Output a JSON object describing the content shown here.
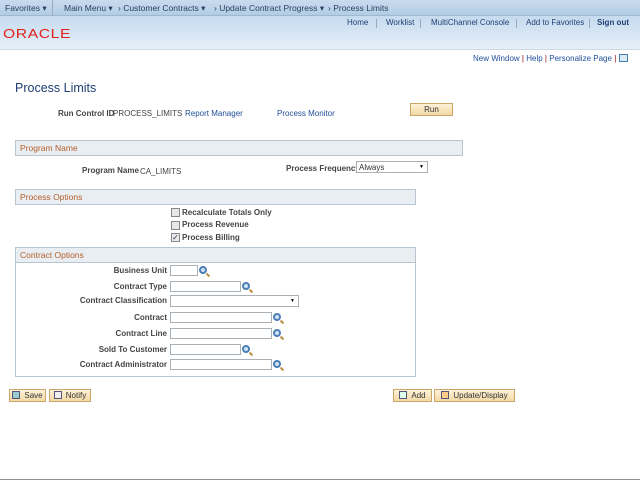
{
  "topnav": {
    "favorites": "Favorites ▾",
    "main_menu": "Main Menu ▾",
    "crumb1": "› Customer Contracts ▾",
    "crumb2": "› Update Contract Progress ▾",
    "crumb3": "› Process Limits"
  },
  "header_links": {
    "home": "Home",
    "worklist": "Worklist",
    "multichannel": "MultiChannel Console",
    "add_favorites": "Add to Favorites",
    "sign_out": "Sign out"
  },
  "logo": "ORACLE",
  "page_links": {
    "new_window": "New Window",
    "help": "Help",
    "personalize": "Personalize Page"
  },
  "page_title": "Process Limits",
  "run_control": {
    "label": "Run Control ID",
    "value": "PROCESS_LIMITS",
    "report_manager": "Report Manager",
    "process_monitor": "Process Monitor",
    "run": "Run"
  },
  "program": {
    "section": "Program Name",
    "label": "Program Name",
    "value": "CA_LIMITS",
    "freq_label": "Process Frequency",
    "freq_value": "Always"
  },
  "options": {
    "section": "Process Options",
    "items": [
      {
        "label": "Recalculate Totals Only",
        "checked": false
      },
      {
        "label": "Process Revenue",
        "checked": false
      },
      {
        "label": "Process Billing",
        "checked": true
      }
    ]
  },
  "contract": {
    "section": "Contract Options",
    "fields": {
      "business_unit": "Business Unit",
      "contract_type": "Contract Type",
      "classification": "Contract Classification",
      "contract": "Contract",
      "contract_line": "Contract Line",
      "sold_to": "Sold To Customer",
      "administrator": "Contract Administrator"
    }
  },
  "buttons": {
    "save": "Save",
    "notify": "Notify",
    "add": "Add",
    "update": "Update/Display"
  },
  "colors": {
    "link": "#1f4e9a",
    "section_title": "#b5602b",
    "oracle_red": "#e0201b"
  }
}
